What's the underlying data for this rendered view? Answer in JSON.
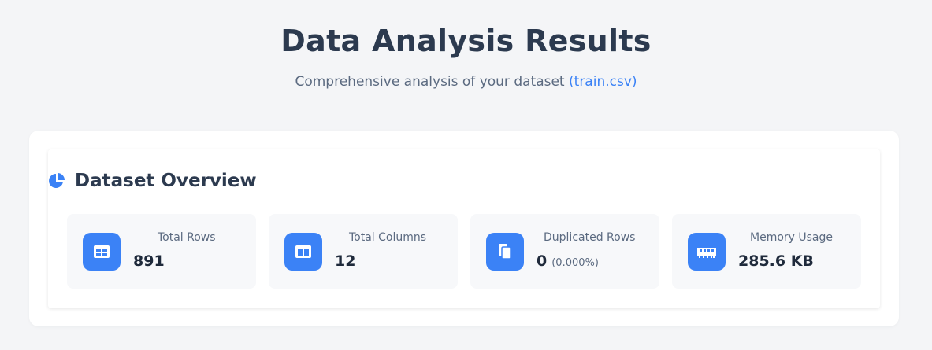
{
  "header": {
    "title": "Data Analysis Results",
    "subtitle": "Comprehensive analysis of your dataset",
    "filename": "(train.csv)"
  },
  "overview": {
    "title": "Dataset Overview",
    "icon": "pie-chart-icon",
    "stats": [
      {
        "label": "Total Rows",
        "value": "891",
        "icon": "table-icon"
      },
      {
        "label": "Total Columns",
        "value": "12",
        "icon": "columns-icon"
      },
      {
        "label": "Duplicated Rows",
        "value": "0",
        "extra": "(0.000%)",
        "icon": "copy-icon"
      },
      {
        "label": "Memory Usage",
        "value": "285.6 KB",
        "icon": "memory-icon"
      }
    ]
  },
  "colors": {
    "accent": "#3b82f6",
    "background": "#f4f5f7",
    "card": "#ffffff",
    "stat_card": "#f7f8fa",
    "text": "#2c3a4f"
  }
}
